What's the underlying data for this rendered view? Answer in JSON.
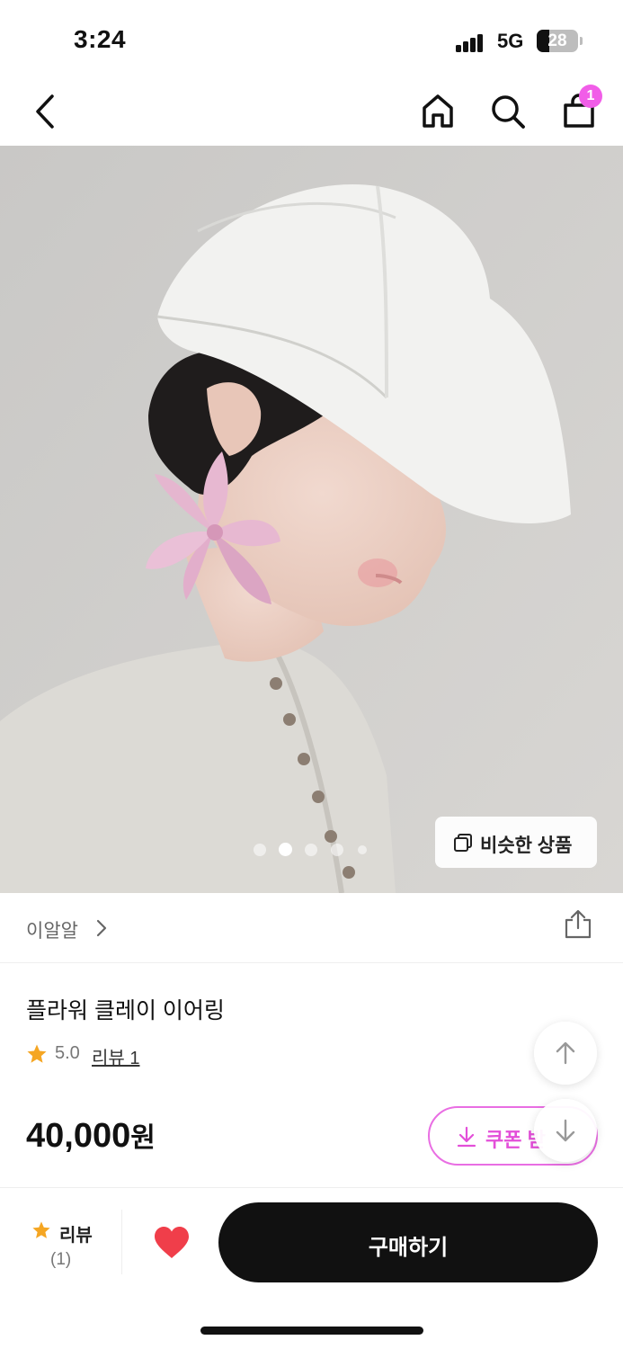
{
  "status_bar": {
    "time": "3:24",
    "network": "5G",
    "battery": "28"
  },
  "nav": {
    "back_icon": "chevron-left-icon",
    "home_icon": "home-icon",
    "search_icon": "search-icon",
    "cart_icon": "shopping-bag-icon",
    "cart_count": "1"
  },
  "gallery": {
    "image_count": 5,
    "active_index": 1,
    "similar_button_label": "비슷한 상품",
    "similar_icon": "copy-icon"
  },
  "brand": {
    "name": "이알알",
    "share_icon": "share-icon"
  },
  "product": {
    "title": "플라워 클레이 이어링",
    "rating": "5.0",
    "review_link": "리뷰 1",
    "price": "40,000",
    "currency": "원"
  },
  "coupon": {
    "label": "쿠폰 받",
    "icon": "download-icon"
  },
  "floating": {
    "up_icon": "arrow-up-icon",
    "down_icon": "arrow-down-icon"
  },
  "bottom_bar": {
    "review_label": "리뷰",
    "review_count": "(1)",
    "wish_icon": "heart-icon",
    "buy_label": "구매하기"
  },
  "colors": {
    "accent_pink": "#e34fd9",
    "badge_pink": "#f15de8",
    "star": "#f5a623",
    "heart": "#f03e4a",
    "primary_button": "#111111"
  }
}
